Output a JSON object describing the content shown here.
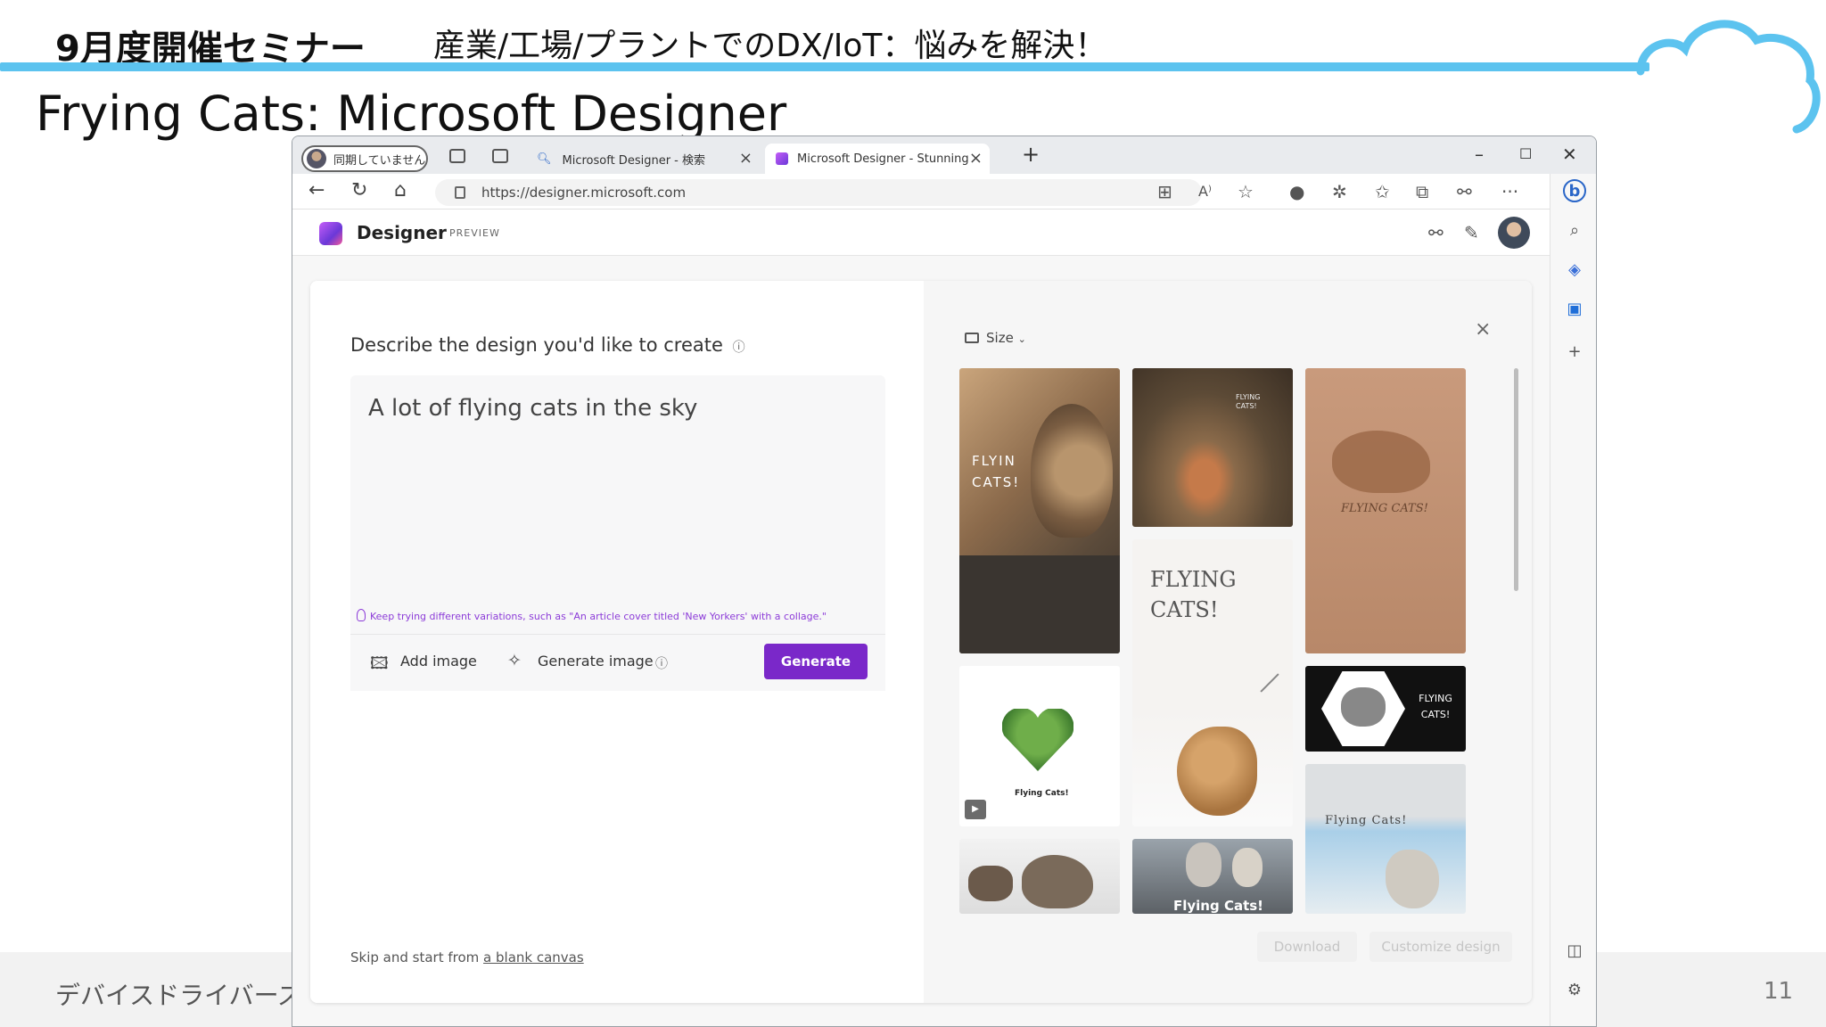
{
  "slide": {
    "seminar_title": "9月度開催セミナー",
    "seminar_subtitle": "産業/工場/プラントでのDX/IoT：悩みを解決！",
    "page_title": "Frying Cats: Microsoft Designer",
    "footer_left": "デバイスドライバーズ",
    "page_number": "11",
    "accent_color": "#5cc3ef"
  },
  "browser": {
    "profile_label": "同期していません",
    "tabs": [
      {
        "label": "Microsoft Designer - 検索",
        "icon": "search-icon",
        "active": false
      },
      {
        "label": "Microsoft Designer - Stunning d",
        "icon": "designer-icon",
        "active": true
      }
    ],
    "new_tab": "+",
    "url": "https://designer.microsoft.com"
  },
  "app": {
    "name": "Designer",
    "badge": "PREVIEW",
    "prompt_heading": "Describe the design you'd like to create",
    "prompt_value": "A lot of flying cats in the sky",
    "tip": "Keep trying different variations, such as \"An article cover titled 'New Yorkers' with a collage.\"",
    "add_image": "Add image",
    "generate_image": "Generate image",
    "generate_button": "Generate",
    "skip_prefix": "Skip and start from ",
    "skip_link": "a blank canvas",
    "size_label": "Size",
    "download_button": "Download",
    "customize_button": "Customize design",
    "brand_color": "#7a28c9"
  },
  "designs": {
    "d1": "FLYIN CATS!",
    "d2": "Flying Cats!",
    "d3": "FLYING CATS!",
    "d4": "FLYING CATS!",
    "d5": "Flying Cats!",
    "d6": "FLYING CATS!",
    "d7": "FLYING CATS!",
    "d8": "Flying Cats!"
  }
}
